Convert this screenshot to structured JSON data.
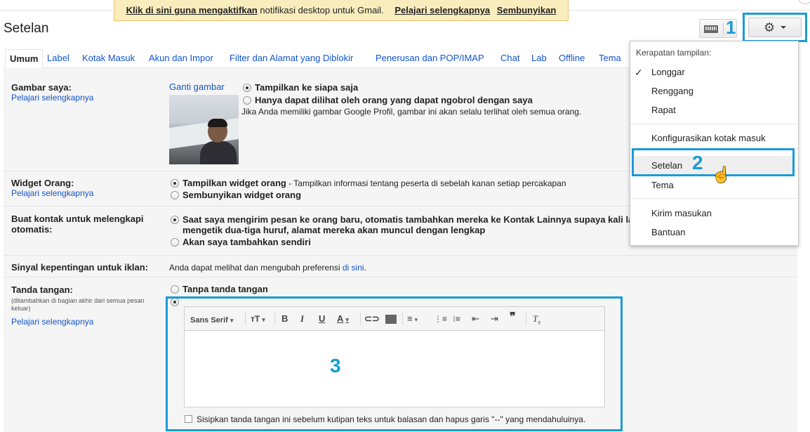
{
  "notification": {
    "enable_link": "Klik di sini guna mengaktifkan",
    "text": "notifikasi desktop untuk Gmail.",
    "learn_link": "Pelajari selengkapnya",
    "hide_link": "Sembunyikan"
  },
  "header": {
    "title": "Setelan",
    "keyboard_icon": "keyboard-icon",
    "gear_icon": "gear-icon"
  },
  "annotations": {
    "one": "1",
    "two": "2",
    "three": "3"
  },
  "tabs": [
    {
      "label": "Umum",
      "active": true
    },
    {
      "label": "Label"
    },
    {
      "label": "Kotak Masuk"
    },
    {
      "label": "Akun dan Impor"
    },
    {
      "label": "Filter dan Alamat yang Diblokir"
    },
    {
      "label": "Penerusan dan POP/IMAP"
    },
    {
      "label": "Chat"
    },
    {
      "label": "Lab"
    },
    {
      "label": "Offline"
    },
    {
      "label": "Tema"
    }
  ],
  "settings": {
    "picture": {
      "label": "Gambar saya:",
      "learn": "Pelajari selengkapnya",
      "change": "Ganti gambar",
      "opt1": "Tampilkan ke siapa saja",
      "opt2": "Hanya dapat dilihat oleh orang yang dapat ngobrol dengan saya",
      "note": "Jika Anda memiliki gambar Google Profil, gambar ini akan selalu terlihat oleh semua orang."
    },
    "widget": {
      "label": "Widget Orang:",
      "learn": "Pelajari selengkapnya",
      "opt1_bold": "Tampilkan widget orang",
      "opt1_rest": " - Tampilkan informasi tentang peserta di sebelah kanan setiap percakapan",
      "opt2": "Sembunyikan widget orang"
    },
    "contacts": {
      "label1": "Buat kontak untuk melengkapi",
      "label2": "otomatis:",
      "opt1_line1": "Saat saya mengirim pesan ke orang baru, otomatis tambahkan mereka ke Kontak Lainnya supaya kali la",
      "opt1_line2": "mengetik dua-tiga huruf, alamat mereka akan muncul dengan lengkap",
      "opt2": "Akan saya tambahkan sendiri"
    },
    "ads": {
      "label": "Sinyal kepentingan untuk iklan:",
      "text": "Anda dapat melihat dan mengubah preferensi",
      "link": "di sini",
      "period": "."
    },
    "signature": {
      "label": "Tanda tangan:",
      "small1": "(ditambahkan di bagian akhir dari semua pesan",
      "small2": "keluar)",
      "learn": "Pelajari selengkapnya",
      "opt_none": "Tanpa tanda tangan",
      "font": "Sans Serif",
      "checkbox": "Sisipkan tanda tangan ini sebelum kutipan teks untuk balasan dan hapus garis \"--\" yang mendahuluinya."
    }
  },
  "menu": {
    "heading": "Kerapatan tampilan:",
    "density": [
      "Longgar",
      "Renggang",
      "Rapat"
    ],
    "configure": "Konfigurasikan kotak masuk",
    "settings": "Setelan",
    "theme": "Tema",
    "feedback": "Kirim masukan",
    "help": "Bantuan"
  }
}
